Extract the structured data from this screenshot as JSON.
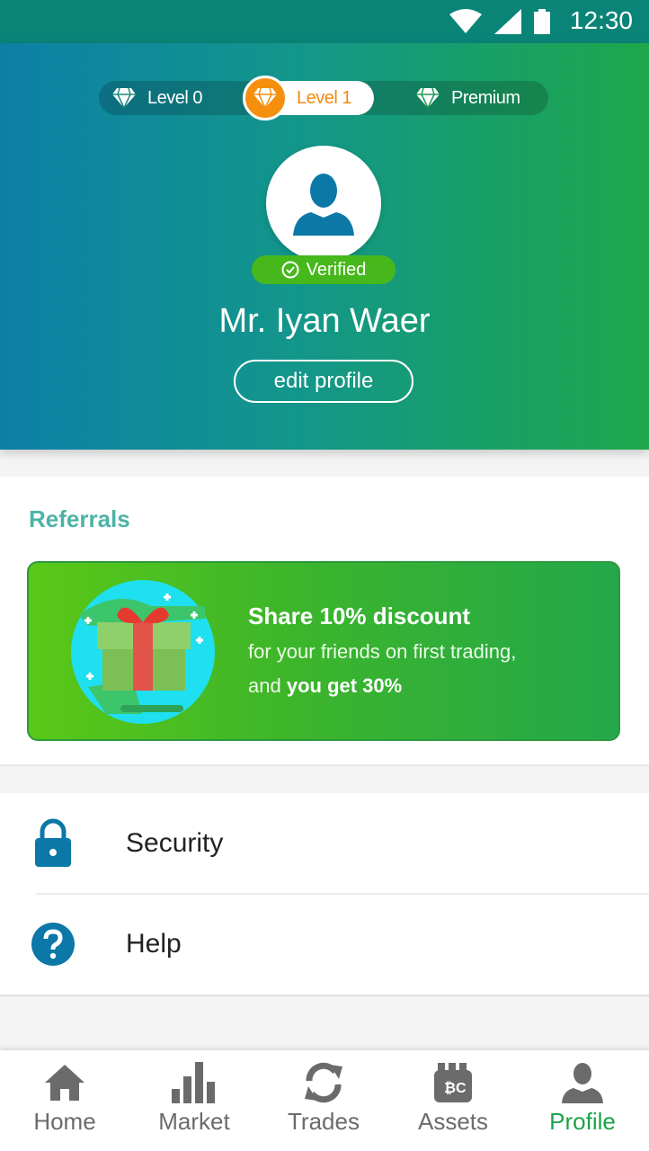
{
  "status_bar": {
    "time": "12:30"
  },
  "levels": [
    {
      "label": "Level 0",
      "icon": "diamond-icon"
    },
    {
      "label": "Level 1",
      "icon": "diamond-icon",
      "selected": true
    },
    {
      "label": "Premium",
      "icon": "diamond-icon"
    }
  ],
  "profile": {
    "name": "Mr. Iyan Waer",
    "verified_label": "Verified",
    "edit_label": "edit profile"
  },
  "referrals": {
    "title": "Referrals",
    "headline": "Share 10% discount",
    "line1": "for your friends on first trading,",
    "line2_prefix": "and",
    "line2_bold": "you get 30%"
  },
  "menu": [
    {
      "label": "Security",
      "icon": "lock-icon"
    },
    {
      "label": "Help",
      "icon": "help-icon"
    }
  ],
  "bottom_nav": [
    {
      "label": "Home",
      "icon": "home-icon"
    },
    {
      "label": "Market",
      "icon": "bar-chart-icon"
    },
    {
      "label": "Trades",
      "icon": "sync-icon"
    },
    {
      "label": "Assets",
      "icon": "wallet-icon"
    },
    {
      "label": "Profile",
      "icon": "person-icon",
      "active": true
    }
  ],
  "colors": {
    "accent": "#1ba34a",
    "header_start": "#0d7fa7",
    "header_end": "#1ea74b",
    "level_active": "#f5900f",
    "icon_blue": "#0b78a8"
  }
}
